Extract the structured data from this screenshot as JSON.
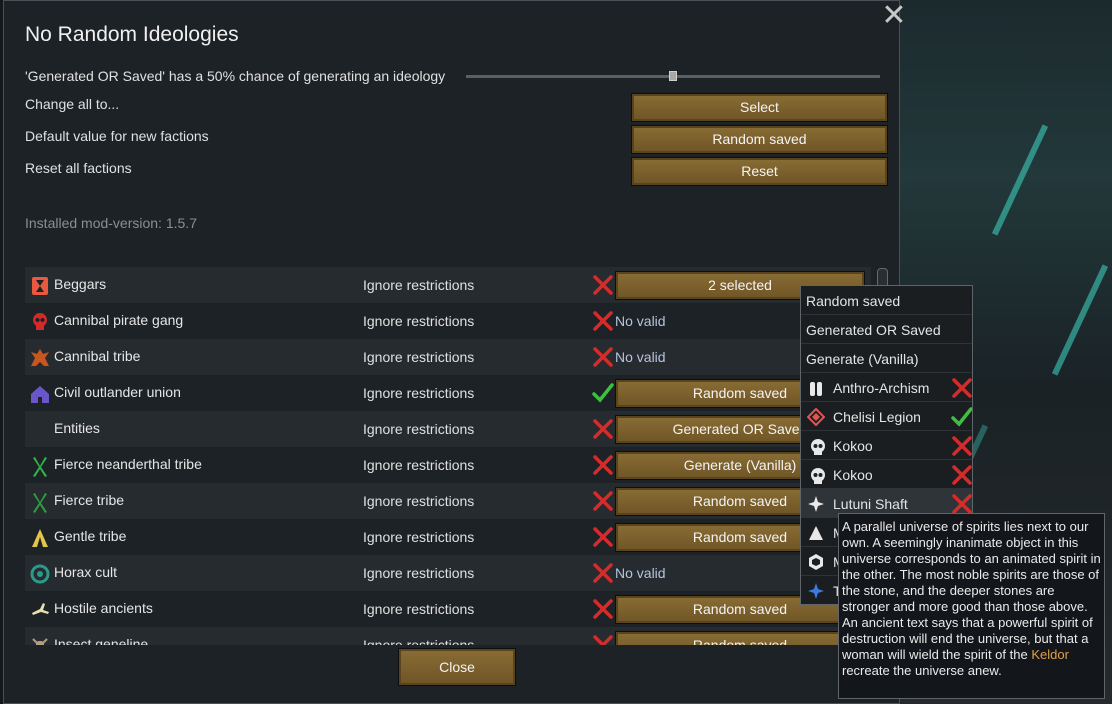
{
  "dialog": {
    "title": "No Random Ideologies",
    "chance_text": "'Generated OR Saved' has a 50% chance of generating an ideology",
    "slider_value_percent": 50,
    "change_all_label": "Change all to...",
    "change_all_button": "Select",
    "default_label": "Default value for new factions",
    "default_button": "Random saved",
    "reset_label": "Reset all factions",
    "reset_button": "Reset",
    "version": "Installed mod-version: 1.5.7",
    "close_button": "Close",
    "close_icon": "close-x-icon"
  },
  "factions": [
    {
      "name": "Beggars",
      "icon": "hourglass-icon",
      "icon_color": "#e8593f",
      "restriction": "Ignore restrictions",
      "valid": false,
      "value": "2 selected"
    },
    {
      "name": "Cannibal pirate gang",
      "icon": "skull-icon",
      "icon_color": "#d02a2a",
      "restriction": "Ignore restrictions",
      "valid": false,
      "value": "No valid"
    },
    {
      "name": "Cannibal tribe",
      "icon": "tribal-mask-icon",
      "icon_color": "#c8561e",
      "restriction": "Ignore restrictions",
      "valid": false,
      "value": "No valid"
    },
    {
      "name": "Civil outlander union",
      "icon": "house-icon",
      "icon_color": "#6a56c8",
      "restriction": "Ignore restrictions",
      "valid": true,
      "value": "Random saved"
    },
    {
      "name": "Entities",
      "icon": "",
      "icon_color": "",
      "restriction": "Ignore restrictions",
      "valid": false,
      "value": "Generated OR Saved"
    },
    {
      "name": "Fierce neanderthal tribe",
      "icon": "tribe-icon",
      "icon_color": "#2fb34a",
      "restriction": "Ignore restrictions",
      "valid": false,
      "value": "Generate (Vanilla)"
    },
    {
      "name": "Fierce tribe",
      "icon": "tribe-icon",
      "icon_color": "#2f9a3e",
      "restriction": "Ignore restrictions",
      "valid": false,
      "value": "Random saved"
    },
    {
      "name": "Gentle tribe",
      "icon": "tent-icon",
      "icon_color": "#e3c54a",
      "restriction": "Ignore restrictions",
      "valid": false,
      "value": "Random saved"
    },
    {
      "name": "Horax cult",
      "icon": "spiral-icon",
      "icon_color": "#2a9a8a",
      "restriction": "Ignore restrictions",
      "valid": false,
      "value": "No valid"
    },
    {
      "name": "Hostile ancients",
      "icon": "runner-icon",
      "icon_color": "#e8e0b0",
      "restriction": "Ignore restrictions",
      "valid": false,
      "value": "Random saved"
    },
    {
      "name": "Insect geneline",
      "icon": "insect-icon",
      "icon_color": "#b0a080",
      "restriction": "Ignore restrictions",
      "valid": false,
      "value": "Random saved"
    }
  ],
  "dropdown": {
    "options": [
      "Random saved",
      "Generated OR Saved",
      "Generate (Vanilla)"
    ],
    "ideologies": [
      {
        "name": "Anthro-Archism",
        "icon": "twin-figure-icon",
        "valid": false
      },
      {
        "name": "Chelisi Legion",
        "icon": "diamond-icon",
        "valid": true
      },
      {
        "name": "Kokoo",
        "icon": "skull-icon",
        "valid": false
      },
      {
        "name": "Kokoo",
        "icon": "skull-icon",
        "valid": false
      },
      {
        "name": "Lutuni Shaft",
        "icon": "star-icon",
        "valid": false
      },
      {
        "name": "M",
        "icon": "triangle-icon",
        "valid": false
      },
      {
        "name": "M",
        "icon": "gem-icon",
        "valid": false
      },
      {
        "name": "T",
        "icon": "cross-star-icon",
        "valid": false
      }
    ]
  },
  "tooltip": {
    "text": "A parallel universe of spirits lies next to our own. A seemingly inanimate object in this universe corresponds to an animated spirit in the other. The most noble spirits are those of the stone, and the deeper stones are stronger and more good than those above. An ancient text says that a powerful spirit of destruction will end the universe, but that a woman will wield the spirit of the",
    "highlight": "Keldor",
    "text_end": "recreate the universe anew."
  },
  "colors": {
    "button": "#7d6230",
    "valid_check": "#3fbf3f",
    "invalid_cross": "#d62b2b",
    "no_valid_text": "#b5c3dc",
    "highlight": "#e0a14a"
  }
}
